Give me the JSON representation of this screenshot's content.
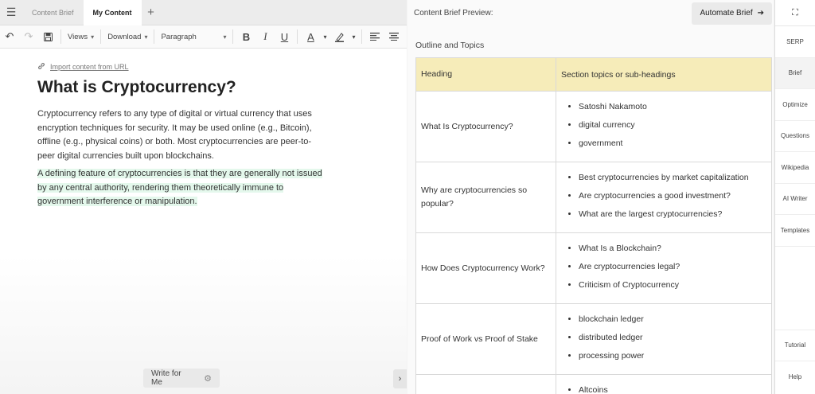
{
  "tabs": {
    "menu_icon": "menu-icon",
    "items": [
      {
        "label": "Content Brief"
      },
      {
        "label": "My Content"
      }
    ],
    "add_icon": "plus-icon"
  },
  "toolbar": {
    "views": "Views",
    "download": "Download",
    "paragraph": "Paragraph"
  },
  "editor": {
    "import_link": "Import content from URL",
    "heading": "What is Cryptocurrency?",
    "paragraph1": "Cryptocurrency refers to any type of digital or virtual currency that uses encryption techniques for security. It may be used online (e.g., Bitcoin), offline (e.g., physical coins) or both. Most cryptocurrencies are peer-to-peer digital currencies built upon blockchains.",
    "paragraph2": "A defining feature of cryptocurrencies is that they are generally not issued by any central authority, rendering them theoretically immune to government interference or manipulation.",
    "write_for_me": "Write for Me"
  },
  "preview": {
    "title": "Content Brief Preview:",
    "automate_label": "Automate Brief",
    "outline_title": "Outline and Topics",
    "col_heading": "Heading",
    "col_topics": "Section topics or sub-headings",
    "rows": [
      {
        "heading": "What Is Cryptocurrency?",
        "topics": [
          "Satoshi Nakamoto",
          "digital currency",
          "government"
        ]
      },
      {
        "heading": "Why are cryptocurrencies so popular?",
        "topics": [
          "Best cryptocurrencies by market capitalization",
          "Are cryptocurrencies a good investment?",
          "What are the largest cryptocurrencies?"
        ]
      },
      {
        "heading": "How Does Cryptocurrency Work?",
        "topics": [
          "What Is a Blockchain?",
          "Are cryptocurrencies legal?",
          "Criticism of Cryptocurrency"
        ]
      },
      {
        "heading": "Proof of Work vs Proof of Stake",
        "topics": [
          "blockchain ledger",
          "distributed ledger",
          "processing power"
        ]
      },
      {
        "heading": "",
        "topics": [
          "Altcoins"
        ]
      }
    ]
  },
  "rail": {
    "expand_icon": "expand-icon",
    "items": [
      "SERP",
      "Brief",
      "Optimize",
      "Questions",
      "Wikipedia",
      "AI Writer",
      "Templates"
    ],
    "bottom": [
      "Tutorial",
      "Help"
    ]
  },
  "colors": {
    "header_fill": "#f6ecb9",
    "highlight": "#e4f8ec"
  }
}
